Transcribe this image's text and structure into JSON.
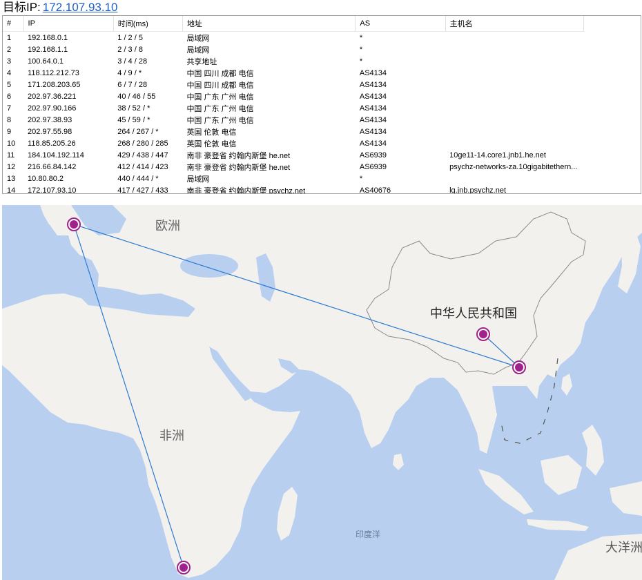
{
  "target": {
    "label": "目标IP:",
    "ip": "172.107.93.10"
  },
  "table": {
    "headers": [
      "#",
      "IP",
      "时间(ms)",
      "地址",
      "AS",
      "主机名"
    ],
    "rows": [
      [
        "1",
        "192.168.0.1",
        "1 / 2 / 5",
        "局域网",
        "*",
        ""
      ],
      [
        "2",
        "192.168.1.1",
        "2 / 3 / 8",
        "局域网",
        "*",
        ""
      ],
      [
        "3",
        "100.64.0.1",
        "3 / 4 / 28",
        "共享地址",
        "*",
        ""
      ],
      [
        "4",
        "118.112.212.73",
        "4 / 9 / *",
        "中国 四川 成都 电信",
        "AS4134",
        ""
      ],
      [
        "5",
        "171.208.203.65",
        "6 / 7 / 28",
        "中国 四川 成都 电信",
        "AS4134",
        ""
      ],
      [
        "6",
        "202.97.36.221",
        "40 / 46 / 55",
        "中国 广东 广州 电信",
        "AS4134",
        ""
      ],
      [
        "7",
        "202.97.90.166",
        "38 / 52 / *",
        "中国 广东 广州 电信",
        "AS4134",
        ""
      ],
      [
        "8",
        "202.97.38.93",
        "45 / 59 / *",
        "中国 广东 广州 电信",
        "AS4134",
        ""
      ],
      [
        "9",
        "202.97.55.98",
        "264 / 267 / *",
        "英国 伦敦 电信",
        "AS4134",
        ""
      ],
      [
        "10",
        "118.85.205.26",
        "268 / 280 / 285",
        "英国 伦敦 电信",
        "AS4134",
        ""
      ],
      [
        "11",
        "184.104.192.114",
        "429 / 438 / 447",
        "南非 豪登省 约翰内斯堡 he.net",
        "AS6939",
        "10ge11-14.core1.jnb1.he.net"
      ],
      [
        "12",
        "216.66.84.142",
        "412 / 414 / 423",
        "南非 豪登省 约翰内斯堡 he.net",
        "AS6939",
        "psychz-networks-za.10gigabitethern..."
      ],
      [
        "13",
        "10.80.80.2",
        "440 / 444 / *",
        "局域网",
        "*",
        ""
      ],
      [
        "14",
        "172.107.93.10",
        "417 / 427 / 433",
        "南非 豪登省 约翰内斯堡 psychz.net",
        "AS40676",
        "lg.jnb.psychz.net"
      ]
    ]
  },
  "map": {
    "labels": {
      "europe": "欧洲",
      "china": "中华人民共和国",
      "africa": "非洲",
      "indian_ocean": "印度洋",
      "oceania": "大洋洲"
    },
    "colors": {
      "water": "#b8cff0",
      "land": "#f2f1ee",
      "border": "#8a8a8a",
      "route": "#2a7ad2",
      "node": "#a0228c"
    }
  }
}
